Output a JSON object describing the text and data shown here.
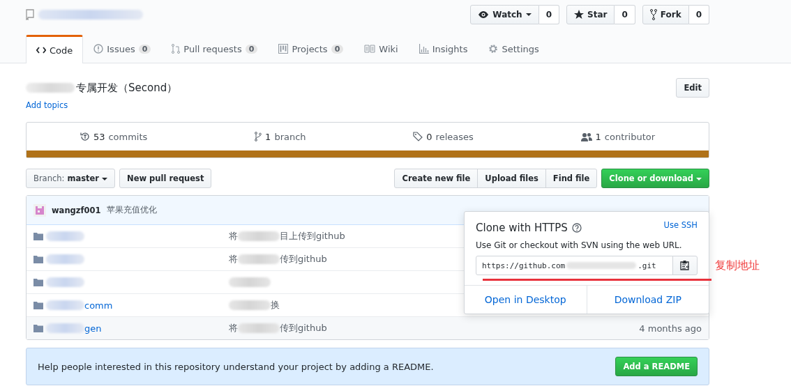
{
  "repo_actions": [
    {
      "kind": "watch",
      "label": "Watch",
      "count": "0"
    },
    {
      "kind": "star",
      "label": "Star",
      "count": "0"
    },
    {
      "kind": "fork",
      "label": "Fork",
      "count": "0"
    }
  ],
  "tabs": [
    {
      "kind": "code",
      "label": "Code",
      "selected": true
    },
    {
      "kind": "issues",
      "label": "Issues",
      "count": "0",
      "selected": false
    },
    {
      "kind": "pulls",
      "label": "Pull requests",
      "count": "0",
      "selected": false
    },
    {
      "kind": "projects",
      "label": "Projects",
      "count": "0",
      "selected": false
    },
    {
      "kind": "wiki",
      "label": "Wiki",
      "selected": false
    },
    {
      "kind": "insights",
      "label": "Insights",
      "selected": false
    },
    {
      "kind": "settings",
      "label": "Settings",
      "selected": false
    }
  ],
  "description": "专属开发（Second）",
  "add_topics": "Add topics",
  "edit_button": "Edit",
  "summary": [
    {
      "kind": "commits",
      "count": "53",
      "label": "commits"
    },
    {
      "kind": "branch",
      "count": "1",
      "label": "branch"
    },
    {
      "kind": "releases",
      "count": "0",
      "label": "releases"
    },
    {
      "kind": "contributors",
      "count": "1",
      "label": "contributor"
    }
  ],
  "branch": {
    "label": "Branch:",
    "value": "master"
  },
  "new_pull_request": "New pull request",
  "file_buttons": [
    "Create new file",
    "Upload files",
    "Find file"
  ],
  "clone_button": "Clone or download",
  "latest_commit": {
    "author": "wangzf001",
    "message": "苹果充值优化"
  },
  "files": [
    {
      "kind": "folder",
      "message_start": "将",
      "message_end": "目上传到github"
    },
    {
      "kind": "folder",
      "message_start": "将",
      "message_end": "传到github"
    },
    {
      "kind": "folder"
    },
    {
      "kind": "folder",
      "name_end": "comm",
      "message_end": "换"
    },
    {
      "kind": "folder",
      "name_end": "gen",
      "message_start": "将",
      "message_end": "传到github",
      "age": "4 months ago"
    }
  ],
  "clone_popup": {
    "title": "Clone with HTTPS",
    "use_ssh": "Use SSH",
    "hint": "Use Git or checkout with SVN using the web URL.",
    "url_start": "https://github.com",
    "url_end": ".git",
    "open_desktop": "Open in Desktop",
    "download_zip": "Download ZIP"
  },
  "annotation": "复制地址",
  "readme": {
    "text": "Help people interested in this repository understand your project by adding a README.",
    "button": "Add a README"
  }
}
